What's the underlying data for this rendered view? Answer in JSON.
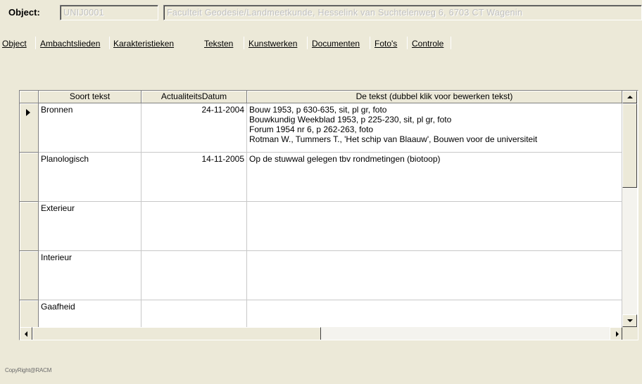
{
  "header": {
    "object_label": "Object:",
    "object_id": "UNIJ0001",
    "object_description": "Faculteit Geodesie/Landmeetkunde, Hesselink van Suchtelenweg 6, 6703 CT Wagenin"
  },
  "tabs": [
    {
      "label": "Object",
      "active": false
    },
    {
      "label": "Ambachtslieden",
      "active": false
    },
    {
      "label": "Karakteristieken",
      "active": false
    },
    {
      "label": "Teksten",
      "active": true
    },
    {
      "label": "Kunstwerken",
      "active": false
    },
    {
      "label": "Documenten",
      "active": false
    },
    {
      "label": "Foto's",
      "active": false
    },
    {
      "label": "Controle",
      "active": false
    }
  ],
  "grid": {
    "columns": [
      "Soort tekst",
      "ActualiteitsDatum",
      "De tekst (dubbel klik voor bewerken tekst)"
    ],
    "rows": [
      {
        "soort": "Bronnen",
        "datum": "24-11-2004",
        "tekst": [
          "Bouw 1953, p 630-635, sit, pl gr, foto",
          "Bouwkundig Weekblad 1953, p 225-230, sit, pl gr, foto",
          "Forum 1954 nr 6, p 262-263, foto",
          "Rotman W., Tummers T., 'Het schip van Blaauw', Bouwen voor de universiteit"
        ],
        "selected": true
      },
      {
        "soort": "Planologisch",
        "datum": "14-11-2005",
        "tekst": [
          "Op de stuwwal gelegen tbv rondmetingen (biotoop)"
        ],
        "selected": false
      },
      {
        "soort": "Exterieur",
        "datum": "",
        "tekst": [
          ""
        ],
        "selected": false
      },
      {
        "soort": "Interieur",
        "datum": "",
        "tekst": [
          ""
        ],
        "selected": false
      },
      {
        "soort": "Gaafheid",
        "datum": "",
        "tekst": [
          ""
        ],
        "selected": false
      }
    ]
  },
  "footer": {
    "copyright": "CopyRight@RACM"
  }
}
